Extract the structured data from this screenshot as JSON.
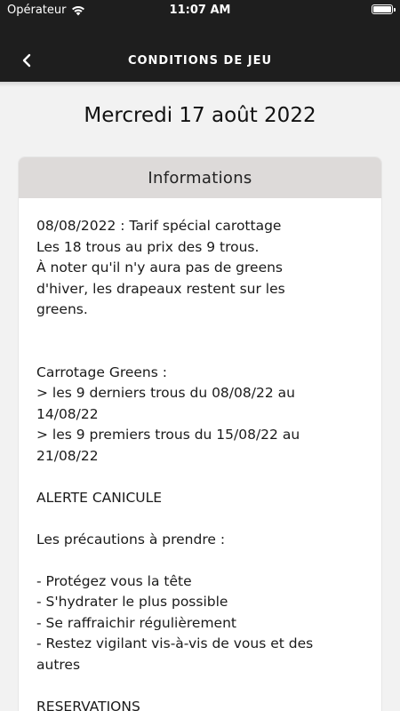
{
  "status_bar": {
    "carrier": "Opérateur",
    "time": "11:07 AM"
  },
  "nav": {
    "title": "CONDITIONS DE JEU"
  },
  "date_title": "Mercredi 17 août 2022",
  "card": {
    "header": "Informations",
    "lines": [
      "08/08/2022 : Tarif spécial carottage",
      "Les 18 trous au prix des 9 trous.",
      "À noter qu'il n'y aura pas de greens",
      "d'hiver, les drapeaux restent sur les",
      "greens.",
      "Carrotage Greens :",
      "> les 9 derniers trous du 08/08/22 au",
      "14/08/22",
      "> les 9 premiers trous du 15/08/22 au",
      "21/08/22",
      "ALERTE CANICULE",
      "Les précautions à prendre :",
      "- Protégez vous la tête",
      "- S'hydrater le plus possible",
      "- Se raffraichir régulièrement",
      "- Restez vigilant vis-à-vis de vous et des",
      "autres",
      "RESERVATIONS"
    ]
  },
  "colors": {
    "topbar": "#1e1e1e",
    "background": "#f2f2f2",
    "card_header": "#dddad9"
  },
  "icons": {
    "back": "chevron-left-icon",
    "wifi": "wifi-icon",
    "battery": "battery-icon"
  }
}
